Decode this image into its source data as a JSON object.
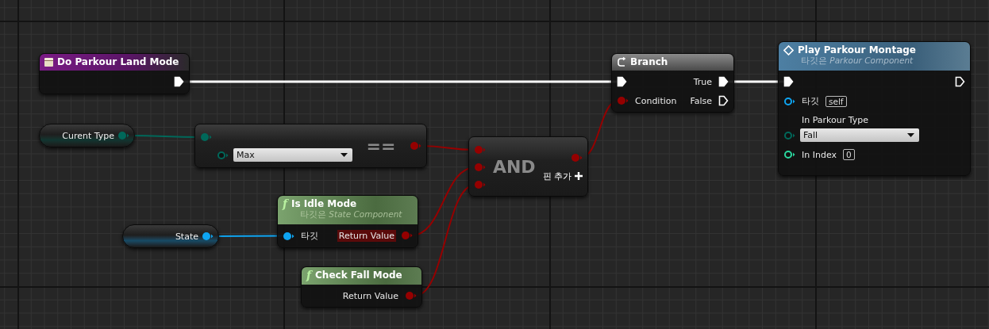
{
  "graph": {
    "nodes": [
      {
        "kind": "event",
        "title": "Do Parkour Land Mode",
        "outputs": [
          {
            "kind": "exec",
            "connected": true
          }
        ]
      },
      {
        "kind": "variable",
        "title": "Curent Type",
        "outputs": [
          {
            "kind": "enum",
            "connected": true
          }
        ]
      },
      {
        "kind": "pure",
        "title": "==",
        "inputs": [
          {
            "kind": "enum",
            "connected": true
          },
          {
            "kind": "enum",
            "connected": false,
            "default": {
              "kind": "dropdown",
              "value": "Max"
            }
          }
        ],
        "outputs": [
          {
            "kind": "bool",
            "connected": true
          }
        ]
      },
      {
        "kind": "pure",
        "title": "AND",
        "add_pin": "핀 추가",
        "inputs": [
          {
            "kind": "bool",
            "connected": true
          },
          {
            "kind": "bool",
            "connected": true
          },
          {
            "kind": "bool",
            "connected": true
          }
        ],
        "outputs": [
          {
            "kind": "bool",
            "connected": true
          }
        ]
      },
      {
        "kind": "flow",
        "title": "Branch",
        "inputs": [
          {
            "kind": "exec",
            "connected": true
          },
          {
            "kind": "bool",
            "connected": true,
            "label": "Condition"
          }
        ],
        "outputs": [
          {
            "kind": "exec",
            "connected": true,
            "label": "True"
          },
          {
            "kind": "exec",
            "connected": false,
            "label": "False"
          }
        ]
      },
      {
        "kind": "call",
        "title": "Play Parkour Montage",
        "subtitle": "타깃은 *Parkour Component*",
        "inputs": [
          {
            "kind": "exec",
            "connected": true
          },
          {
            "kind": "object",
            "connected": false,
            "label": "타깃",
            "default": {
              "kind": "box",
              "value": "self"
            }
          },
          {
            "kind": "enum",
            "connected": false,
            "label": "In Parkour Type",
            "default": {
              "kind": "dropdown",
              "value": "Fall"
            }
          },
          {
            "kind": "int",
            "connected": false,
            "label": "In Index",
            "default": {
              "kind": "box",
              "value": "0"
            }
          }
        ],
        "outputs": [
          {
            "kind": "exec",
            "connected": false
          }
        ]
      },
      {
        "kind": "variable",
        "title": "State",
        "outputs": [
          {
            "kind": "object",
            "connected": true
          }
        ]
      },
      {
        "kind": "function",
        "glyph": "f",
        "title": "Is Idle Mode",
        "subtitle": "타깃은 *State Component*",
        "inputs": [
          {
            "kind": "object",
            "connected": true,
            "label": "타깃"
          }
        ],
        "outputs": [
          {
            "kind": "bool",
            "connected": true,
            "label": "Return Value",
            "highlighted": true
          }
        ]
      },
      {
        "kind": "function",
        "glyph": "f",
        "title": "Check Fall Mode",
        "outputs": [
          {
            "kind": "bool",
            "connected": true,
            "label": "Return Value",
            "highlighted": false
          }
        ]
      }
    ]
  }
}
